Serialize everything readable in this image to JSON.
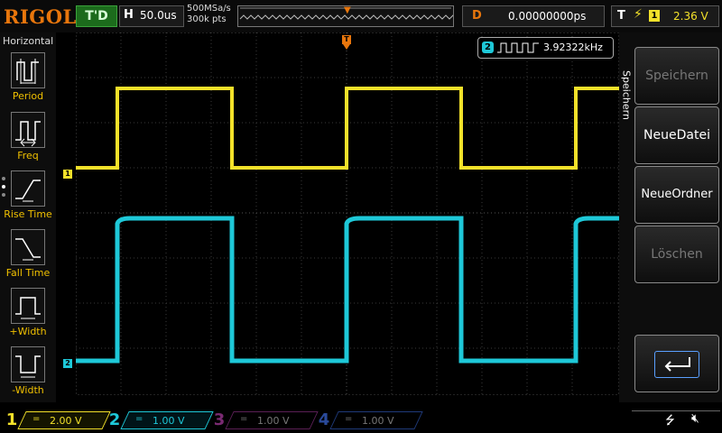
{
  "header": {
    "logo": "RIGOL",
    "run_status": "T'D",
    "timebase_key": "H",
    "timebase_value": "50.0us",
    "sample_rate": "500MSa/s",
    "memory_depth": "300k pts",
    "delay_key": "D",
    "delay_value": "0.00000000ps",
    "trigger_key": "T",
    "trigger_source": "1",
    "trigger_level": "2.36 V"
  },
  "left_menu": {
    "title": "Horizontal",
    "items": [
      {
        "label": "Period",
        "icon": "period-icon"
      },
      {
        "label": "Freq",
        "icon": "freq-icon"
      },
      {
        "label": "Rise Time",
        "icon": "rise-time-icon"
      },
      {
        "label": "Fall Time",
        "icon": "fall-time-icon"
      },
      {
        "label": "+Width",
        "icon": "pos-width-icon"
      },
      {
        "label": "-Width",
        "icon": "neg-width-icon"
      }
    ]
  },
  "display": {
    "ch1_marker": "1",
    "ch2_marker": "2",
    "measurement_channel": "2",
    "measurement_value": "3.92322kHz",
    "trigger_marker": "T"
  },
  "right_menu": {
    "title": "Speichern",
    "buttons": [
      {
        "label": "Speichern",
        "enabled": false
      },
      {
        "label": "NeueDatei",
        "enabled": true
      },
      {
        "label": "NeueOrdner",
        "enabled": true
      },
      {
        "label": "Löschen",
        "enabled": false
      }
    ]
  },
  "channels": [
    {
      "num": "1",
      "coupling": "=",
      "scale": "2.00 V",
      "color": "#f3e12a",
      "active": true
    },
    {
      "num": "2",
      "coupling": "=",
      "scale": "1.00 V",
      "color": "#1ec8d8",
      "active": true
    },
    {
      "num": "3",
      "coupling": "=",
      "scale": "1.00 V",
      "color": "#c02ab0",
      "active": false
    },
    {
      "num": "4",
      "coupling": "=",
      "scale": "1.00 V",
      "color": "#2a5ed8",
      "active": false
    }
  ],
  "colors": {
    "ch1": "#f3e12a",
    "ch2": "#1ec8d8",
    "accent": "#e8760c",
    "run_green": "#1c6b1c"
  }
}
